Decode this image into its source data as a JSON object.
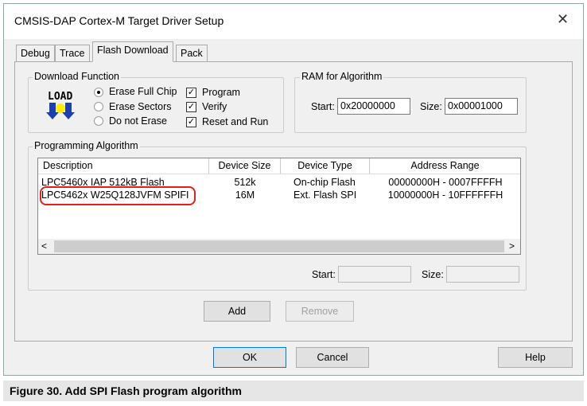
{
  "window": {
    "title": "CMSIS-DAP Cortex-M Target Driver Setup",
    "close": "✕"
  },
  "tabs": [
    "Debug",
    "Trace",
    "Flash Download",
    "Pack"
  ],
  "download_function": {
    "label": "Download Function",
    "icon_text": "LOAD",
    "radios": [
      {
        "label": "Erase Full Chip",
        "selected": true
      },
      {
        "label": "Erase Sectors",
        "selected": false
      },
      {
        "label": "Do not Erase",
        "selected": false
      }
    ],
    "checks": [
      {
        "label": "Program",
        "checked": true
      },
      {
        "label": "Verify",
        "checked": true
      },
      {
        "label": "Reset and Run",
        "checked": true
      }
    ]
  },
  "ram": {
    "label": "RAM for Algorithm",
    "start_label": "Start:",
    "start": "0x20000000",
    "size_label": "Size:",
    "size": "0x00001000"
  },
  "algorithm": {
    "label": "Programming Algorithm",
    "columns": [
      "Description",
      "Device Size",
      "Device Type",
      "Address Range"
    ],
    "rows": [
      [
        "LPC5460x IAP 512kB Flash",
        "512k",
        "On-chip Flash",
        "00000000H - 0007FFFFH"
      ],
      [
        "LPC5462x W25Q128JVFM SPIFI",
        "16M",
        "Ext. Flash SPI",
        "10000000H - 10FFFFFFH"
      ]
    ],
    "start_label": "Start:",
    "start": "",
    "size_label": "Size:",
    "size": "",
    "highlight_color": "#e02020"
  },
  "buttons": {
    "add": "Add",
    "remove": "Remove",
    "ok": "OK",
    "cancel": "Cancel",
    "help": "Help"
  },
  "caption": "Figure 30.  Add SPI Flash program algorithm"
}
